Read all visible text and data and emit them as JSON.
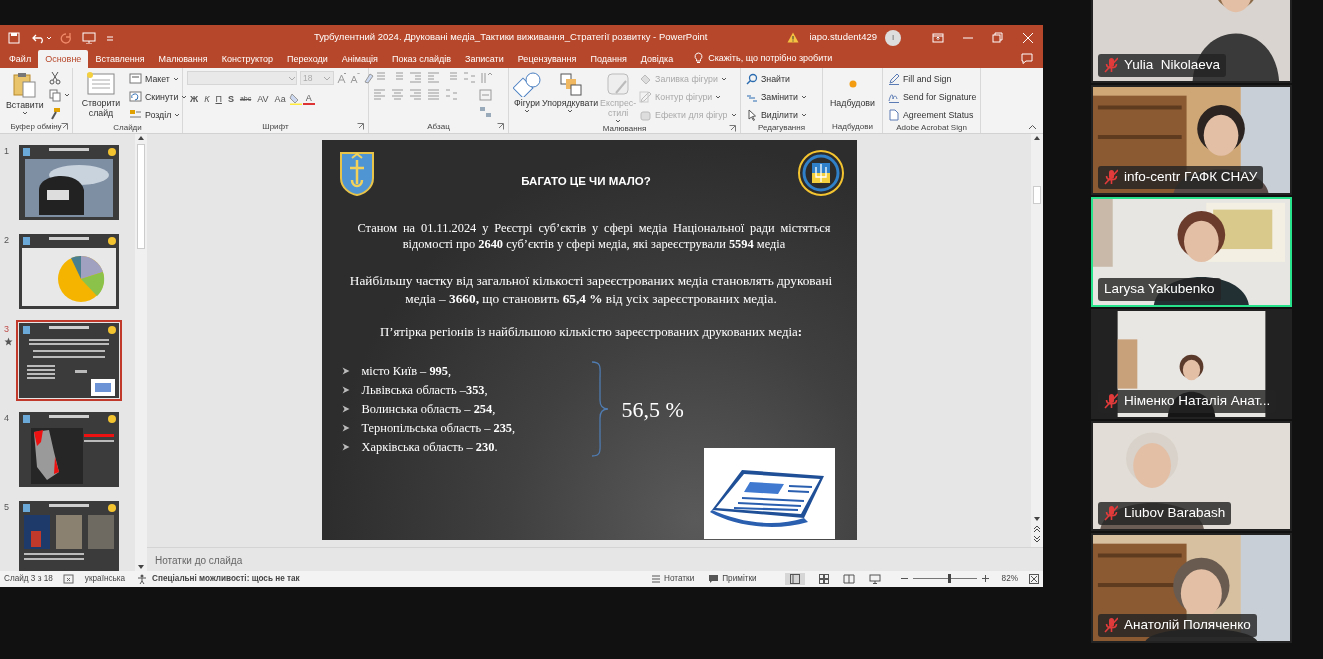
{
  "window": {
    "title": "Турбулентний 2024. Друковані медіа_Тактики виживання_Стратегії розвитку  -  PowerPoint",
    "user": "iapo.student429",
    "avatar_initial": "I"
  },
  "ribbon_tabs": [
    {
      "label": "Файл",
      "selected": false
    },
    {
      "label": "Основне",
      "selected": true
    },
    {
      "label": "Вставлення",
      "selected": false
    },
    {
      "label": "Малювання",
      "selected": false
    },
    {
      "label": "Конструктор",
      "selected": false
    },
    {
      "label": "Переходи",
      "selected": false
    },
    {
      "label": "Анімація",
      "selected": false
    },
    {
      "label": "Показ слайдів",
      "selected": false
    },
    {
      "label": "Записати",
      "selected": false
    },
    {
      "label": "Рецензування",
      "selected": false
    },
    {
      "label": "Подання",
      "selected": false
    },
    {
      "label": "Довідка",
      "selected": false
    }
  ],
  "tell_me": "Скажіть, що потрібно зробити",
  "ribbon": {
    "clipboard": {
      "label": "Буфер обміну",
      "paste": "Вставити"
    },
    "slides": {
      "label": "Слайди",
      "new_slide": "Створити слайд",
      "layout": "Макет",
      "reset": "Скинути",
      "section": "Розділ"
    },
    "font": {
      "label": "Шрифт",
      "size": "18",
      "format_buttons": [
        "Ж",
        "К",
        "П",
        "S",
        "abc",
        "AV",
        "Аа",
        "A"
      ]
    },
    "paragraph": {
      "label": "Абзац"
    },
    "drawing": {
      "label": "Малювання",
      "tools": [
        {
          "label": "Фігури",
          "disabled": false
        },
        {
          "label": "Упорядкувати",
          "disabled": false
        },
        {
          "label": "Експрес-стилі",
          "disabled": true
        }
      ],
      "shape_options": [
        {
          "label": "Заливка фігури",
          "disabled": true
        },
        {
          "label": "Контур фігури",
          "disabled": true
        },
        {
          "label": "Ефекти для фігур",
          "disabled": true
        }
      ]
    },
    "editing": {
      "label": "Редагування",
      "find": "Знайти",
      "replace": "Замінити",
      "select": "Виділити"
    },
    "addins": {
      "label": "Надбудови",
      "button": "Надбудови"
    },
    "acrobat": {
      "label": "Adobe Acrobat Sign",
      "items": [
        "Fill and Sign",
        "Send for Signature",
        "Agreement Status"
      ]
    }
  },
  "thumbnails": [
    {
      "number": "1",
      "selected": false,
      "has_transition": false
    },
    {
      "number": "2",
      "selected": false,
      "has_transition": false
    },
    {
      "number": "3",
      "selected": true,
      "has_transition": true
    },
    {
      "number": "4",
      "selected": false,
      "has_transition": false
    },
    {
      "number": "5",
      "selected": false,
      "has_transition": false
    }
  ],
  "slide": {
    "title": "БАГАТО ЦЕ ЧИ МАЛО?",
    "paragraphs": [
      "Станом на 01.11.2024 у Реєстрі суб’єктів у сфері медіа Національної ради містяться відомості про **2640** суб’єктів у сфері медіа, які зареєстрували **5594** медіа",
      "Найбільшу частку від загальної кількості зареєстрованих медіа становлять друковані медіа – **3660,** що становить **65,4 %** від усіх зареєстрованих медіа.",
      "П’ятірка регіонів із найбільшою кількістю зареєстрованих друкованих медіа**:**"
    ],
    "regions": [
      "місто Київ – **995**,",
      "Львівська область –**353**,",
      "Волинська область – **254**,",
      "Тернопільська область – **235**,",
      "Харківська область – **230**."
    ],
    "share": "56,5 %"
  },
  "notes": {
    "placeholder": "Нотатки до слайда"
  },
  "status_bar": {
    "slide_counter": "Слайд 3 з 18",
    "language": "українська",
    "accessibility": "Спеціальні можливості: щось не так",
    "notes_button": "Нотатки",
    "comments_button": "Примітки",
    "zoom_slider": {
      "level": 0.55
    },
    "zoom": "82%"
  },
  "participants": [
    {
      "name": "Yulia  Nikolaeva",
      "muted": true,
      "speaking": false
    },
    {
      "name": "info-centr ГАФК СНАУ",
      "muted": true,
      "speaking": false
    },
    {
      "name": "Larysa Yakubenko",
      "muted": false,
      "speaking": true
    },
    {
      "name": "Німенко Наталія Анат...",
      "muted": true,
      "speaking": false
    },
    {
      "name": "Liubov Barabash",
      "muted": true,
      "speaking": false
    },
    {
      "name": "Анатолій Поляченко",
      "muted": true,
      "speaking": false
    }
  ]
}
